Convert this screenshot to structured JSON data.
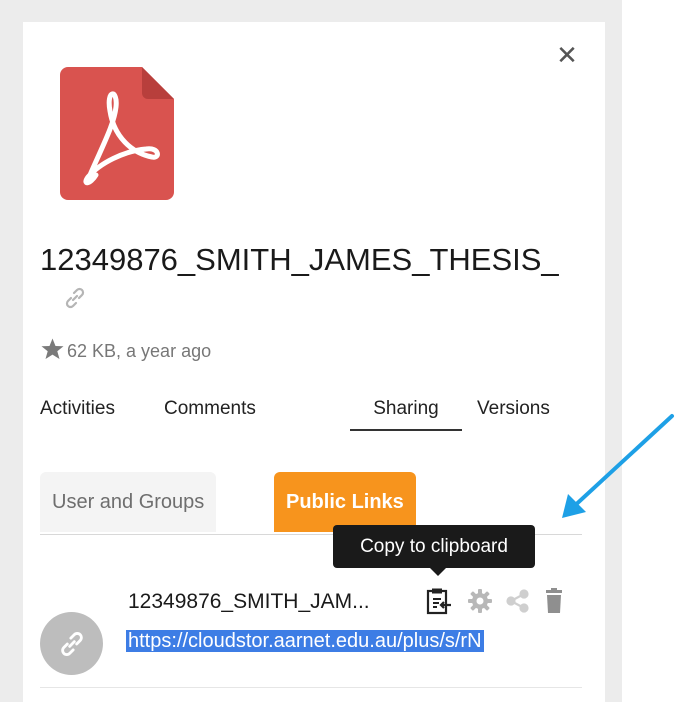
{
  "panel": {
    "close_label": "✕",
    "file_title": "12349876_SMITH_JAMES_THESIS_",
    "meta_text": "62 KB, a year ago"
  },
  "tabs": [
    {
      "label": "Activities"
    },
    {
      "label": "Comments"
    },
    {
      "label": "Sharing"
    },
    {
      "label": "Versions"
    }
  ],
  "sharing": {
    "subtabs": [
      {
        "label": "User and Groups"
      },
      {
        "label": "Public Links"
      }
    ],
    "tooltip": "Copy to clipboard",
    "link_name": "12349876_SMITH_JAM...",
    "link_url": "https://cloudstor.aarnet.edu.au/plus/s/rN"
  },
  "colors": {
    "accent": "#f7941d",
    "pdf_red": "#d9534f",
    "selection": "#3d7de5",
    "arrow": "#1ea0e6"
  },
  "icons": {
    "pdf": "pdf-file-icon",
    "close": "close-icon",
    "link": "link-icon",
    "star": "star-icon",
    "clipboard": "clipboard-icon",
    "gear": "gear-icon",
    "share": "share-icon",
    "trash": "trash-icon"
  }
}
